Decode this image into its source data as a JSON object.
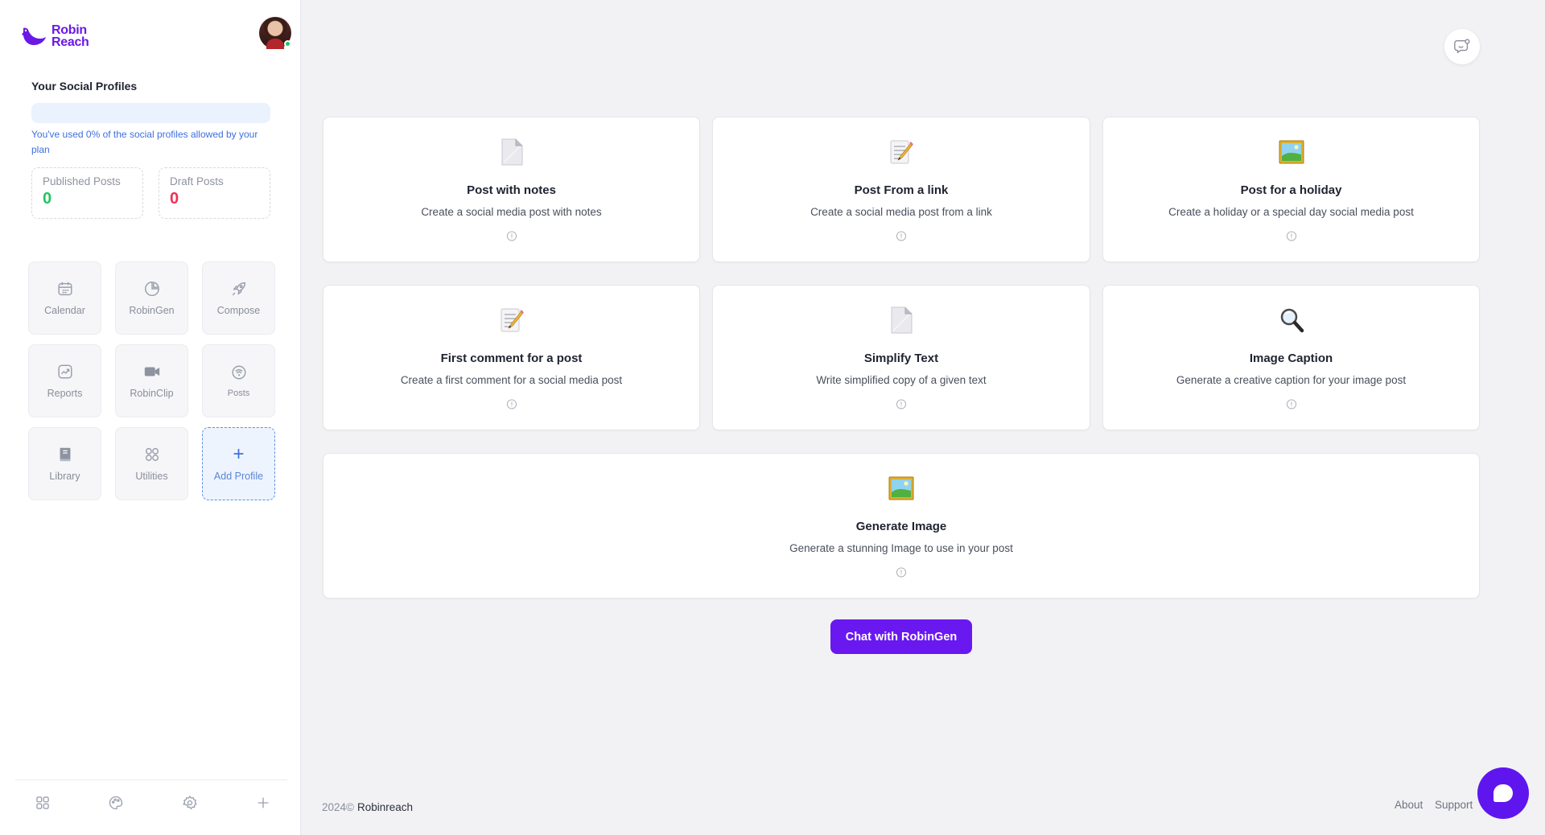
{
  "brand": {
    "logo_line1": "Robin",
    "logo_line2": "Reach",
    "accent": "#6a18e6"
  },
  "sidebar": {
    "profiles_title": "Your Social Profiles",
    "usage_percent": 0,
    "usage_text": "You've used 0% of the social profiles allowed by your plan",
    "stats": [
      {
        "label": "Published Posts",
        "value": "0",
        "color": "#22c55e"
      },
      {
        "label": "Draft Posts",
        "value": "0",
        "color": "#ef2f55"
      }
    ],
    "tiles": [
      {
        "label": "Calendar",
        "icon": "calendar-icon"
      },
      {
        "label": "RobinGen",
        "icon": "robingen-icon"
      },
      {
        "label": "Compose",
        "icon": "rocket-icon"
      },
      {
        "label": "Reports",
        "icon": "reports-icon"
      },
      {
        "label": "RobinClip",
        "icon": "video-icon"
      },
      {
        "label": "Posts",
        "icon": "posts-icon"
      },
      {
        "label": "Library",
        "icon": "book-icon"
      },
      {
        "label": "Utilities",
        "icon": "grid-icon"
      },
      {
        "label": "Add Profile",
        "icon": "plus-icon"
      }
    ],
    "bottom_icons": [
      "dashboard-icon",
      "palette-icon",
      "settings-icon",
      "add-icon"
    ]
  },
  "cards": [
    {
      "title": "Post with notes",
      "desc": "Create a social media post with notes",
      "icon": "document-icon"
    },
    {
      "title": "Post From a link",
      "desc": "Create a social media post from a link",
      "icon": "memo-icon"
    },
    {
      "title": "Post for a holiday",
      "desc": "Create a holiday or a special day social media post",
      "icon": "picture-icon"
    },
    {
      "title": "First comment for a post",
      "desc": "Create a first comment for a social media post",
      "icon": "memo-icon"
    },
    {
      "title": "Simplify Text",
      "desc": "Write simplified copy of a given text",
      "icon": "document-icon"
    },
    {
      "title": "Image Caption",
      "desc": "Generate a creative caption for your image post",
      "icon": "magnifier-icon"
    },
    {
      "title": "Generate Image",
      "desc": "Generate a stunning Image to use in your post",
      "icon": "picture-icon"
    }
  ],
  "chat_button": "Chat with RobinGen",
  "footer": {
    "year": "2024©",
    "brand": "Robinreach",
    "about": "About",
    "support": "Support"
  }
}
